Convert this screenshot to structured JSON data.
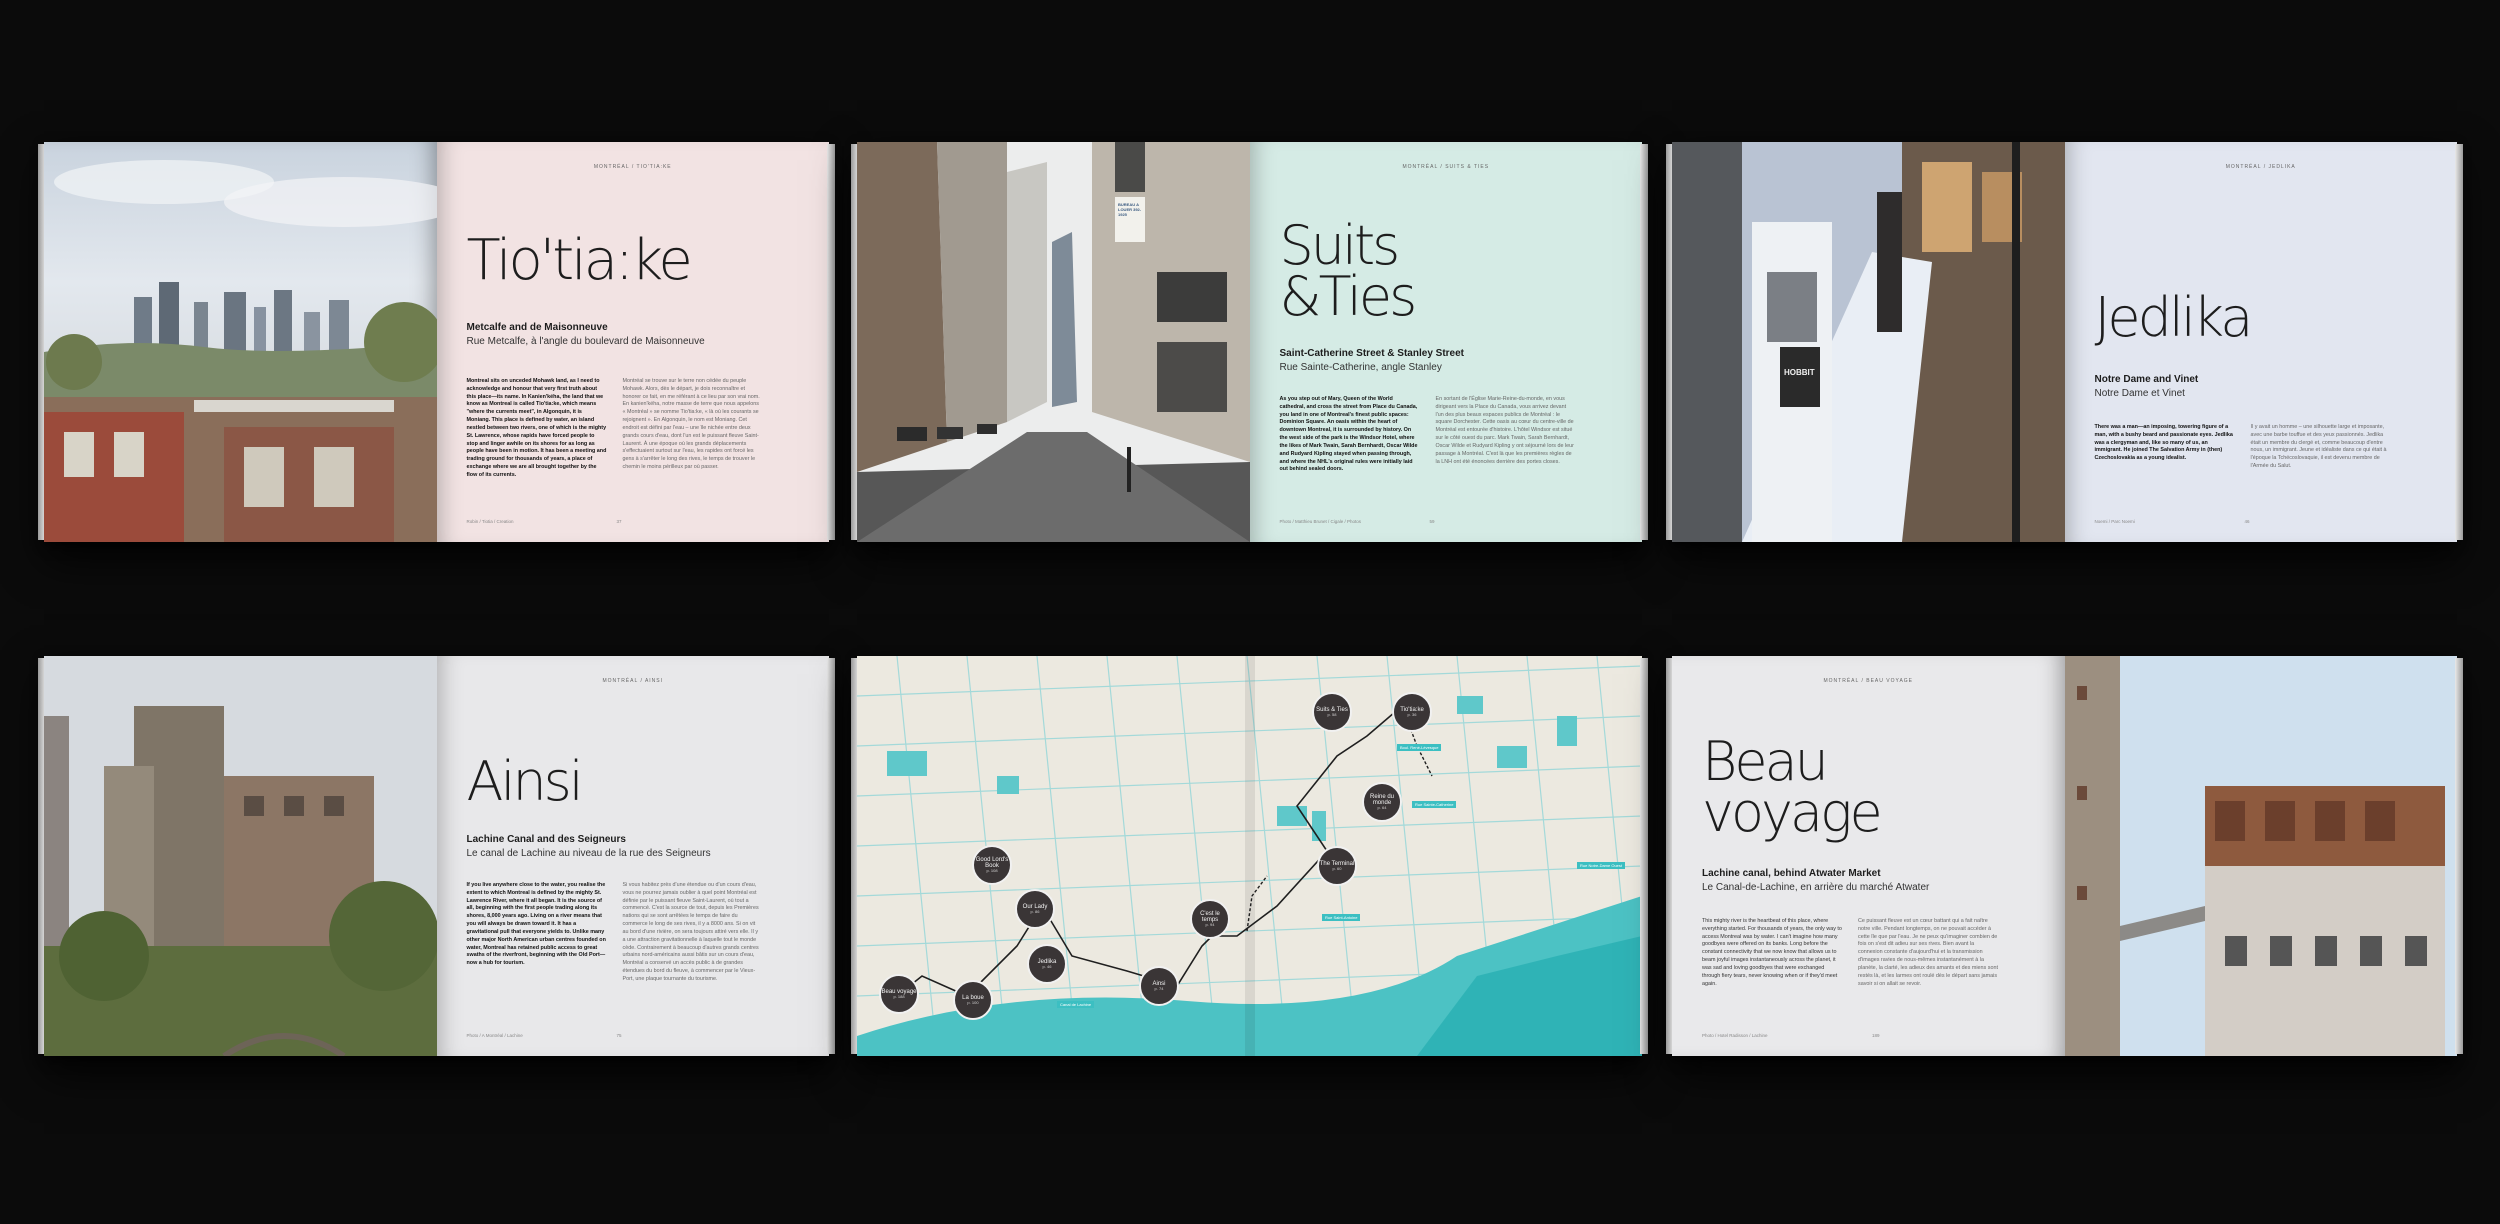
{
  "books": [
    {
      "runhead": "Montréal / Tio'tia:ke",
      "title": "Tio'tia:ke",
      "subtitle": "Metcalfe and de Maisonneuve",
      "subtitle_fr": "Rue Metcalfe, à l'angle du boulevard de Maisonneuve",
      "col1": "Montreal sits on unceded Mohawk land, as I need to acknowledge and honour that very first truth about this place—its name. In Kanien'kéha, the land that we know as Montreal is called Tio'tia:ke, which means \"where the currents meet\", in Algonquin, it is Moniang. This place is defined by water, an island nestled between two rivers, one of which is the mighty St. Lawrence, whose rapids have forced people to stop and linger awhile on its shores for as long as people have been in motion. It has been a meeting and trading ground for thousands of years, a place of exchange where we are all brought together by the flow of its currents.",
      "col2": "Montréal se trouve sur le terre non cédée du peuple Mohawk. Alors, dès le départ, je dois reconnaître et honorer ce fait, en me référant à ce lieu par son vrai nom. En kanien'kéha, notre masse de terre que nous appelons « Montréal » se nomme Tio'tia:ke, « là où les courants se rejoignent ». En Algonquin, le nom est Moniang. Cet endroit est défini par l'eau – une île nichée entre deux grands cours d'eau, dont l'un est le puissant fleuve Saint-Laurent. À une époque où les grands déplacements s'effectuaient surtout sur l'eau, les rapides ont forcé les gens à s'arrêter le long des rives, le temps de trouver le chemin le moins périlleux par où passer.",
      "folio_left": "Robin / Tiotia / Creation",
      "folio_right": "37"
    },
    {
      "runhead": "Montréal / Suits & Ties",
      "title": "Suits\n&Ties",
      "subtitle": "Saint-Catherine Street & Stanley Street",
      "subtitle_fr": "Rue Sainte-Catherine, angle Stanley",
      "col1": "As you step out of Mary, Queen of the World cathedral, and cross the street from Place du Canada, you land in one of Montreal's finest public spaces: Dominion Square. An oasis within the heart of downtown Montreal, it is surrounded by history. On the west side of the park is the Windsor Hotel, where the likes of Mark Twain, Sarah Bernhardt, Oscar Wilde and Rudyard Kipling stayed when passing through, and where the NHL's original rules were initially laid out behind sealed doors.",
      "col2": "En sortant de l'Église Marie-Reine-du-monde, en vous dirigeant vers la Place du Canada, vous arrivez devant l'un des plus beaux espaces publics de Montréal : le square Dorchester. Cette oasis au cœur du centre-ville de Montréal est entourée d'histoire. L'hôtel Windsor est situé sur le côté ouest du parc. Mark Twain, Sarah Bernhardt, Oscar Wilde et Rudyard Kipling y ont séjourné lors de leur passage à Montréal. C'est là que les premières règles de la LNH ont été énoncées derrière des portes closes.",
      "folio_left": "Photo / Matthieu Brunet / Cigale / Photos",
      "folio_right": "59",
      "sign": "BUREAU A LOUER 392-1925"
    },
    {
      "runhead": "Montréal / Jedlika",
      "title": "Jedlika",
      "subtitle": "Notre Dame and Vinet",
      "subtitle_fr": "Notre Dame et Vinet",
      "col1": "There was a man—an imposing, towering figure of a man, with a bushy beard and passionate eyes. Jedlika was a clergyman and, like so many of us, an immigrant. He joined The Salvation Army in (then) Czechoslovakia as a young idealist.",
      "col2": "Il y avait un homme – une silhouette large et imposante, avec une barbe touffue et des yeux passionnés. Jedlika était un membre du clergé et, comme beaucoup d'entre nous, un immigrant. Jeune et idéaliste dans ce qui était à l'époque la Tchécoslovaquie, il est devenu membre de l'Armée du Salut.",
      "folio_left": "Noemi / Parc Noemi",
      "folio_right": "46",
      "poster": "HOBBIT"
    },
    {
      "runhead": "Montréal / Ainsi",
      "title": "Ainsi",
      "subtitle": "Lachine Canal and des Seigneurs",
      "subtitle_fr": "Le canal de Lachine au niveau de la rue des Seigneurs",
      "col1": "If you live anywhere close to the water, you realise the extent to which Montreal is defined by the mighty St. Lawrence River, where it all began. It is the source of all, beginning with the first people trading along its shores, 8,000 years ago. Living on a river means that you will always be drawn toward it. It has a gravitational pull that everyone yields to. Unlike many other major North American urban centres founded on water, Montreal has retained public access to great swaths of the riverfront, beginning with the Old Port—now a hub for tourism.",
      "col2": "Si vous habitez près d'une étendue ou d'un cours d'eau, vous ne pourrez jamais oublier à quel point Montréal est définie par le puissant fleuve Saint-Laurent, où tout a commencé. C'est la source de tout, depuis les Premières nations qui se sont arrêtées le temps de faire du commerce le long de ses rives, il y a 8000 ans. Si on vit au bord d'une rivière, on sera toujours attiré vers elle. Il y a une attraction gravitationnelle à laquelle tout le monde cède. Contrairement à beaucoup d'autres grands centres urbains nord-américains aussi bâtis sur un cours d'eau, Montréal a conservé un accès public à de grandes étendues du bord du fleuve, à commencer par le Vieux-Port, une plaque tournante du tourisme.",
      "folio_left": "Photo / A Montréal / Lachine",
      "folio_right": "75"
    },
    {
      "stops": [
        {
          "name": "Suits & Ties",
          "num": "p. 58"
        },
        {
          "name": "Tio'tia:ke",
          "num": "p. 36"
        },
        {
          "name": "Reine du monde",
          "num": "p. 64"
        },
        {
          "name": "The Terminal",
          "num": "p. 60"
        },
        {
          "name": "C'est le temps",
          "num": "p. 94"
        },
        {
          "name": "Good Lord's Book",
          "num": "p. 108"
        },
        {
          "name": "Our Lady",
          "num": "p. 86"
        },
        {
          "name": "Jedlika",
          "num": "p. 46"
        },
        {
          "name": "Ainsi",
          "num": "p. 74"
        },
        {
          "name": "Beau voyage",
          "num": "p. 188"
        },
        {
          "name": "La boue",
          "num": "p. 100"
        }
      ],
      "labels": [
        "Boul. René-Lévesque",
        "Rue Sainte-Catherine",
        "Rue Notre-Dame Ouest",
        "Rue Saint-Antoine",
        "Canal de Lachine"
      ]
    },
    {
      "runhead": "Montréal / Beau voyage",
      "title": "Beau\nvoyage",
      "subtitle": "Lachine canal, behind Atwater Market",
      "subtitle_fr": "Le Canal-de-Lachine, en arrière du marché Atwater",
      "col1": "This mighty river is the heartbeat of this place, where everything started. For thousands of years, the only way to access Montreal was by water. I can't imagine how many goodbyes were offered on its banks. Long before the constant connectivity that we now know that allows us to beam joyful images instantaneously across the planet, it was sad and loving goodbyes that were exchanged through fiery tears, never knowing when or if they'd meet again.",
      "col2": "Ce puissant fleuve est un cœur battant qui a fait naître notre ville. Pendant longtemps, on ne pouvait accéder à cette île que par l'eau. Je ne peux qu'imaginer combien de fois on s'est dit adieu sur ses rives. Bien avant la connexion constante d'aujourd'hui et la transmission d'images ravies de nous-mêmes instantanément à la planète, la clarté, les adieux des amants et des miens sont restés là, et les larmes ont roulé dès le départ sans jamais savoir si on allait se revoir.",
      "folio_left": "Photo / Hotel Radisson / Lachine",
      "folio_right": "189"
    }
  ],
  "colors": {
    "background": "#0b0b0b",
    "pink_page": "#f2e3e3",
    "mint_page": "#d5ebe5",
    "blue_page": "#e2e6f0",
    "grey_page": "#e8e8ea",
    "map_water": "#3cbfc2",
    "map_land": "#ece9e0",
    "stop_fill": "#3a3536"
  }
}
